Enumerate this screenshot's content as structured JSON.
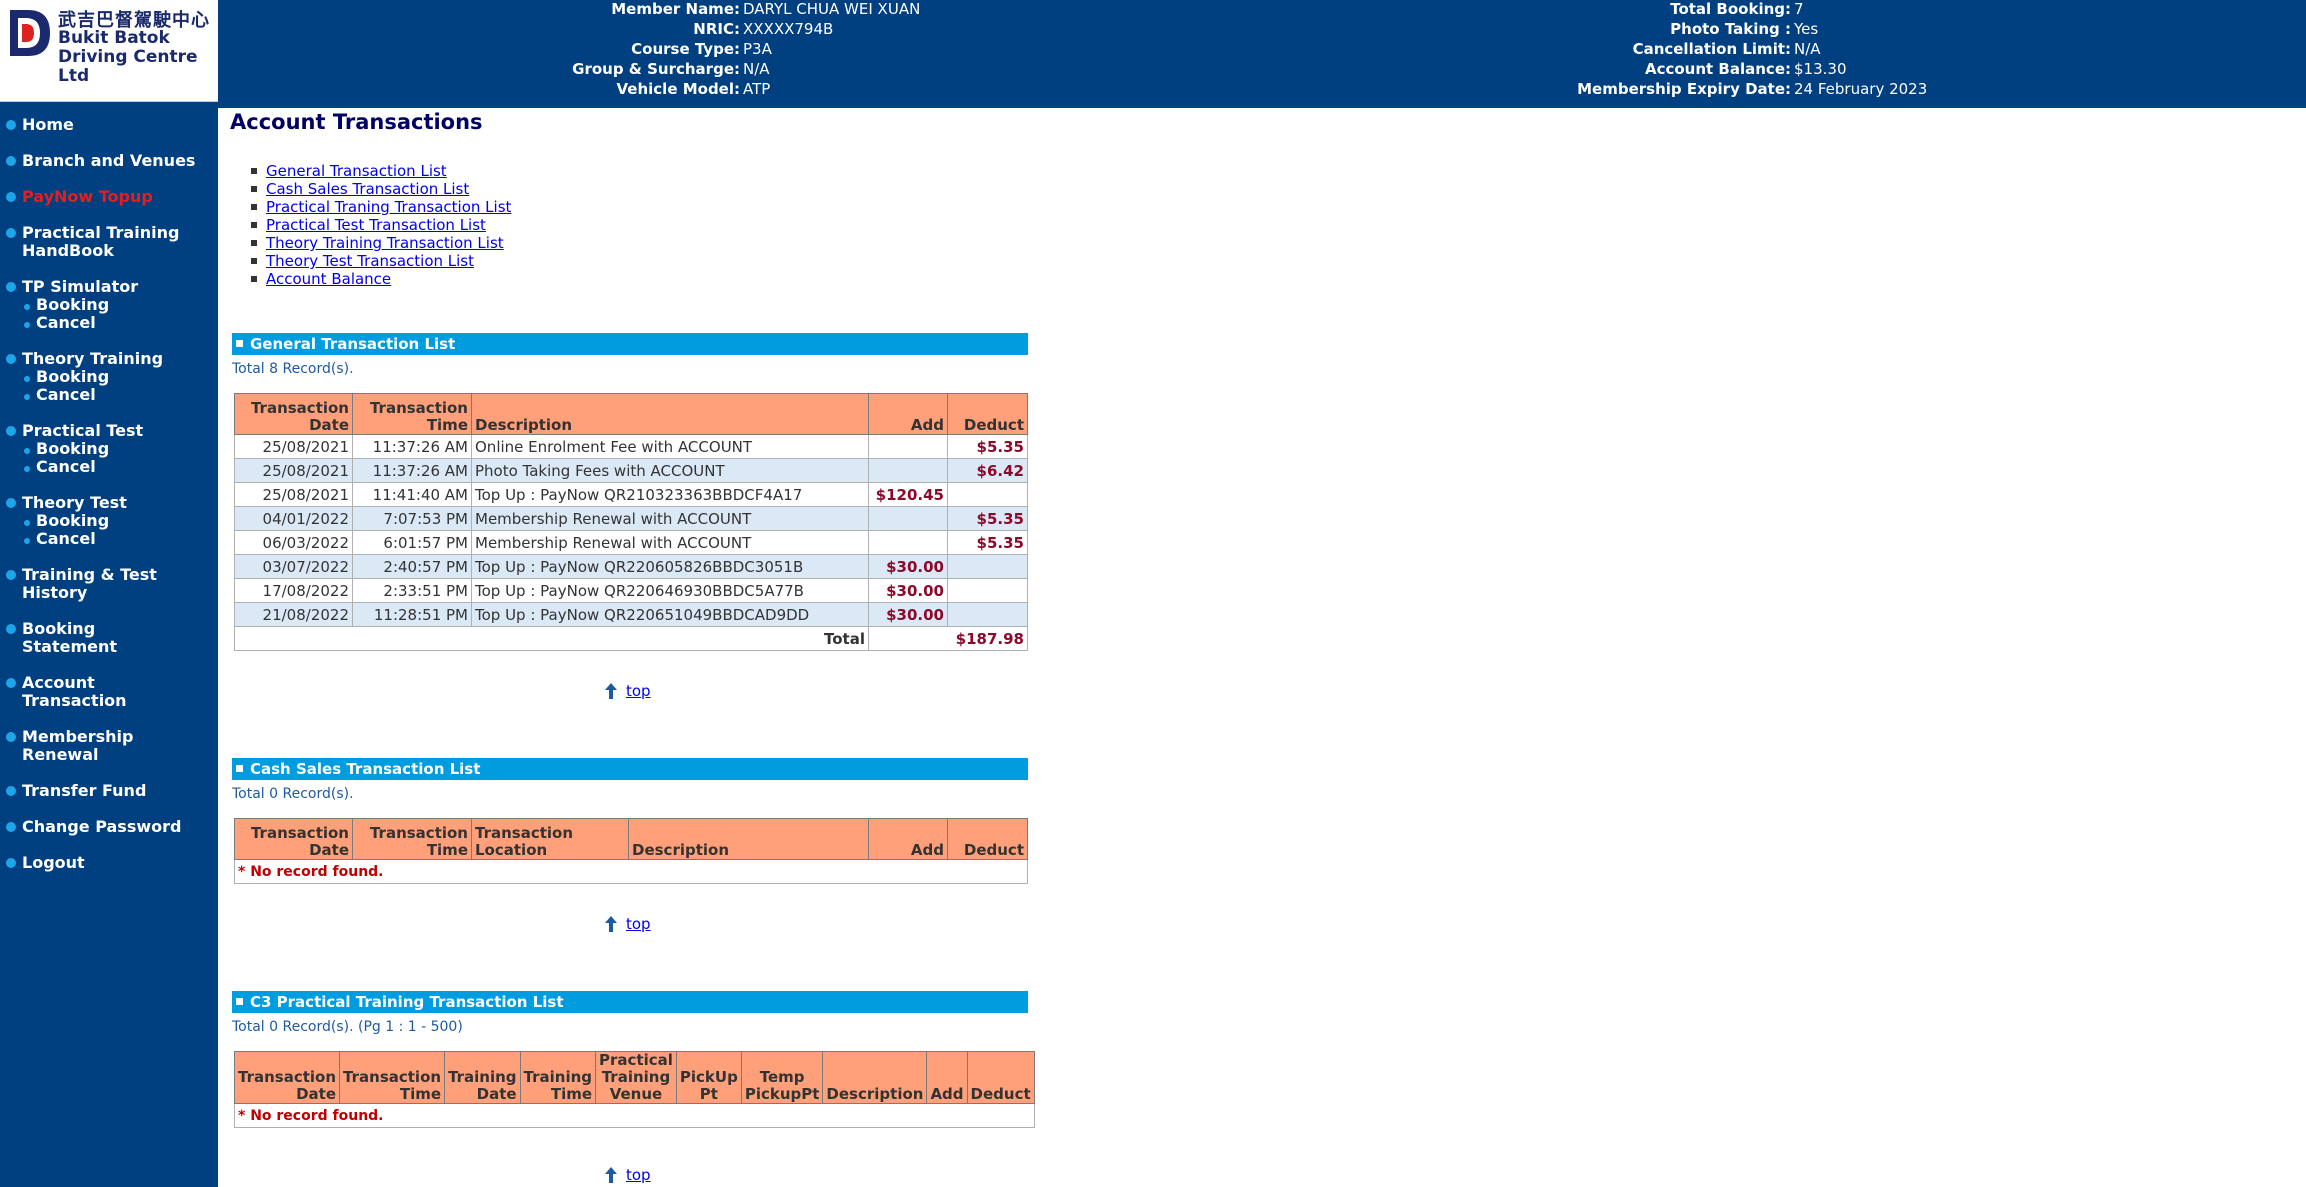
{
  "logo": {
    "chinese": "武吉巴督駕駛中心",
    "english": [
      "Bukit Batok",
      "Driving Centre",
      "Ltd"
    ]
  },
  "header": {
    "left": [
      {
        "label": "Member Name:",
        "value": "DARYL CHUA WEI XUAN"
      },
      {
        "label": "NRIC:",
        "value": "XXXXX794B"
      },
      {
        "label": "Course Type:",
        "value": "P3A"
      },
      {
        "label": "Group & Surcharge:",
        "value": "N/A"
      },
      {
        "label": "Vehicle Model:",
        "value": "ATP"
      }
    ],
    "right": [
      {
        "label": "Total Booking:",
        "value": "7"
      },
      {
        "label": "Photo Taking :",
        "value": "Yes"
      },
      {
        "label": "Cancellation Limit:",
        "value": "N/A"
      },
      {
        "label": "Account Balance:",
        "value": "$13.30"
      },
      {
        "label": "Membership Expiry Date:",
        "value": "24 February 2023"
      }
    ]
  },
  "sidebar": {
    "home": "Home",
    "branch": "Branch and Venues",
    "paynow": "PayNow Topup",
    "handbook": [
      "Practical Training",
      "HandBook"
    ],
    "tp_sim": "TP Simulator",
    "theory_training": "Theory Training",
    "practical_test": "Practical Test",
    "theory_test": "Theory Test",
    "booking": "Booking",
    "cancel": "Cancel",
    "history": [
      "Training & Test",
      "History"
    ],
    "statement": [
      "Booking",
      "Statement"
    ],
    "account": [
      "Account",
      "Transaction"
    ],
    "membership": [
      "Membership",
      "Renewal"
    ],
    "transfer": "Transfer Fund",
    "password": "Change Password",
    "logout": "Logout",
    "accent_color": "#e02020"
  },
  "page": {
    "title": "Account Transactions",
    "links": [
      "General Transaction List",
      "Cash Sales Transaction List",
      "Practical Traning Transaction List",
      "Practical Test Transaction List",
      "Theory Training Transaction List",
      "Theory Test Transaction List",
      "Account Balance"
    ],
    "top_label": "top"
  },
  "general": {
    "title": "General Transaction List",
    "total": "Total 8 Record(s).",
    "headers": {
      "date": [
        "Transaction",
        "Date"
      ],
      "time": [
        "Transaction",
        "Time"
      ],
      "desc": "Description",
      "add": "Add",
      "deduct": "Deduct"
    },
    "rows": [
      {
        "date": "25/08/2021",
        "time": "11:37:26 AM",
        "desc": "Online Enrolment Fee with ACCOUNT",
        "add": "",
        "deduct": "$5.35"
      },
      {
        "date": "25/08/2021",
        "time": "11:37:26 AM",
        "desc": "Photo Taking Fees with ACCOUNT",
        "add": "",
        "deduct": "$6.42"
      },
      {
        "date": "25/08/2021",
        "time": "11:41:40 AM",
        "desc": "Top Up : PayNow QR210323363BBDCF4A17",
        "add": "$120.45",
        "deduct": ""
      },
      {
        "date": "04/01/2022",
        "time": "7:07:53 PM",
        "desc": "Membership Renewal with ACCOUNT",
        "add": "",
        "deduct": "$5.35"
      },
      {
        "date": "06/03/2022",
        "time": "6:01:57 PM",
        "desc": "Membership Renewal with ACCOUNT",
        "add": "",
        "deduct": "$5.35"
      },
      {
        "date": "03/07/2022",
        "time": "2:40:57 PM",
        "desc": "Top Up : PayNow QR220605826BBDC3051B",
        "add": "$30.00",
        "deduct": ""
      },
      {
        "date": "17/08/2022",
        "time": "2:33:51 PM",
        "desc": "Top Up : PayNow QR220646930BBDC5A77B",
        "add": "$30.00",
        "deduct": ""
      },
      {
        "date": "21/08/2022",
        "time": "11:28:51 PM",
        "desc": "Top Up : PayNow QR220651049BBDCAD9DD",
        "add": "$30.00",
        "deduct": ""
      }
    ],
    "total_label": "Total",
    "total_value": "$187.98"
  },
  "cash": {
    "title": "Cash Sales Transaction List",
    "total": "Total 0 Record(s).",
    "headers": {
      "date": [
        "Transaction",
        "Date"
      ],
      "time": [
        "Transaction",
        "Time"
      ],
      "loc": [
        "Transaction",
        "Location"
      ],
      "desc": "Description",
      "add": "Add",
      "deduct": "Deduct"
    },
    "empty": "* No record found."
  },
  "c3": {
    "title": "C3 Practical Training Transaction List",
    "total": "Total 0 Record(s). (Pg 1 : 1 - 500)",
    "headers": {
      "tdate": [
        "Transaction",
        "Date"
      ],
      "ttime": [
        "Transaction",
        "Time"
      ],
      "trdate": [
        "Training",
        "Date"
      ],
      "trtime": [
        "Training",
        "Time"
      ],
      "venue": [
        "Practical",
        "Training",
        "Venue"
      ],
      "pickup": [
        "PickUp",
        "Pt"
      ],
      "temp": [
        "Temp",
        "PickupPt"
      ],
      "desc": "Description",
      "add": "Add",
      "deduct": "Deduct"
    },
    "empty": "* No record found."
  }
}
